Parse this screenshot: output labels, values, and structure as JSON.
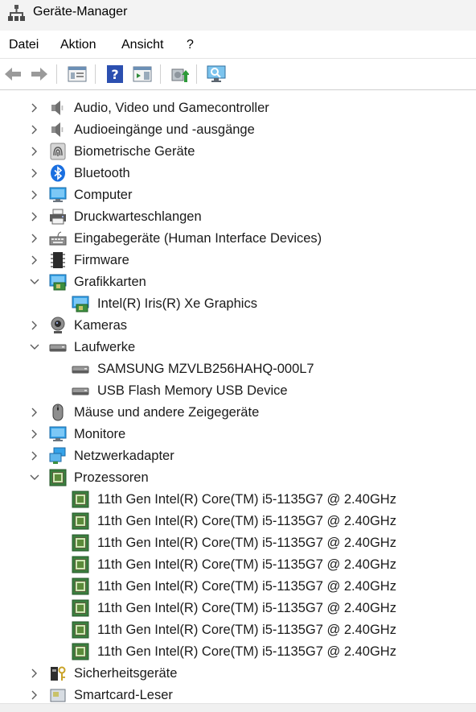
{
  "window": {
    "title": "Geräte-Manager"
  },
  "menu": [
    "Datei",
    "Aktion",
    "Ansicht",
    "?"
  ],
  "toolbar": [
    "back-icon",
    "forward-icon",
    "properties-view-icon",
    "help-icon",
    "action-pane-icon",
    "update-driver-icon",
    "scan-hardware-icon"
  ],
  "tree": [
    {
      "label": "Audio, Video und Gamecontroller",
      "icon": "speaker-icon",
      "expanded": false
    },
    {
      "label": "Audioeingänge und -ausgänge",
      "icon": "speaker-icon",
      "expanded": false
    },
    {
      "label": "Biometrische Geräte",
      "icon": "fingerprint-icon",
      "expanded": false
    },
    {
      "label": "Bluetooth",
      "icon": "bluetooth-icon",
      "expanded": false
    },
    {
      "label": "Computer",
      "icon": "monitor-icon",
      "expanded": false
    },
    {
      "label": "Druckwarteschlangen",
      "icon": "printer-icon",
      "expanded": false
    },
    {
      "label": "Eingabegeräte (Human Interface Devices)",
      "icon": "keyboard-icon",
      "expanded": false
    },
    {
      "label": "Firmware",
      "icon": "chip-icon",
      "expanded": false
    },
    {
      "label": "Grafikkarten",
      "icon": "display-adapter-icon",
      "expanded": true,
      "children": [
        {
          "label": "Intel(R) Iris(R) Xe Graphics",
          "icon": "display-adapter-icon"
        }
      ]
    },
    {
      "label": "Kameras",
      "icon": "webcam-icon",
      "expanded": false
    },
    {
      "label": "Laufwerke",
      "icon": "drive-icon",
      "expanded": true,
      "children": [
        {
          "label": "SAMSUNG MZVLB256HAHQ-000L7",
          "icon": "drive-icon"
        },
        {
          "label": "USB Flash Memory USB Device",
          "icon": "drive-icon"
        }
      ]
    },
    {
      "label": "Mäuse und andere Zeigegeräte",
      "icon": "mouse-icon",
      "expanded": false
    },
    {
      "label": "Monitore",
      "icon": "monitor-icon",
      "expanded": false
    },
    {
      "label": "Netzwerkadapter",
      "icon": "network-icon",
      "expanded": false
    },
    {
      "label": "Prozessoren",
      "icon": "processor-icon",
      "expanded": true,
      "children": [
        {
          "label": "11th Gen Intel(R) Core(TM) i5-1135G7 @ 2.40GHz",
          "icon": "processor-icon"
        },
        {
          "label": "11th Gen Intel(R) Core(TM) i5-1135G7 @ 2.40GHz",
          "icon": "processor-icon"
        },
        {
          "label": "11th Gen Intel(R) Core(TM) i5-1135G7 @ 2.40GHz",
          "icon": "processor-icon"
        },
        {
          "label": "11th Gen Intel(R) Core(TM) i5-1135G7 @ 2.40GHz",
          "icon": "processor-icon"
        },
        {
          "label": "11th Gen Intel(R) Core(TM) i5-1135G7 @ 2.40GHz",
          "icon": "processor-icon"
        },
        {
          "label": "11th Gen Intel(R) Core(TM) i5-1135G7 @ 2.40GHz",
          "icon": "processor-icon"
        },
        {
          "label": "11th Gen Intel(R) Core(TM) i5-1135G7 @ 2.40GHz",
          "icon": "processor-icon"
        },
        {
          "label": "11th Gen Intel(R) Core(TM) i5-1135G7 @ 2.40GHz",
          "icon": "processor-icon"
        }
      ]
    },
    {
      "label": "Sicherheitsgeräte",
      "icon": "security-device-icon",
      "expanded": false
    },
    {
      "label": "Smartcard-Leser",
      "icon": "smartcard-reader-icon",
      "expanded": false
    }
  ]
}
